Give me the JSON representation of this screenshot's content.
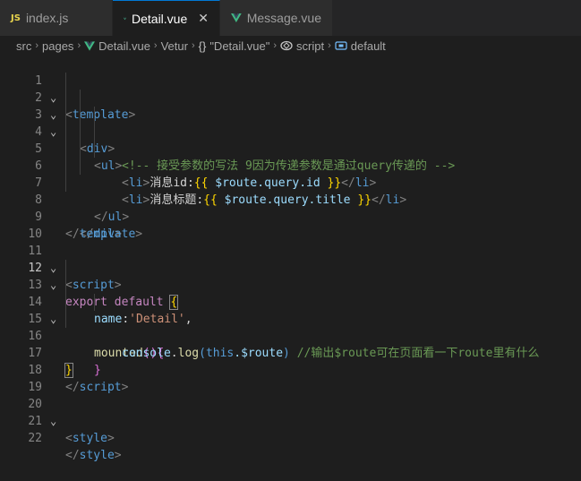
{
  "tabs": [
    {
      "label": "index.js",
      "icon": "js-icon",
      "active": false
    },
    {
      "label": "Detail.vue",
      "icon": "vue-icon",
      "active": true,
      "close": "✕"
    },
    {
      "label": "Message.vue",
      "icon": "vue-icon",
      "active": false
    }
  ],
  "breadcrumb": {
    "items": [
      "src",
      "pages",
      "Detail.vue",
      "Vetur",
      "\"Detail.vue\"",
      "script",
      "default"
    ],
    "separator": "›"
  },
  "line_numbers": [
    "1",
    "2",
    "3",
    "4",
    "5",
    "6",
    "7",
    "8",
    "9",
    "10",
    "11",
    "12",
    "13",
    "14",
    "15",
    "16",
    "17",
    "18",
    "19",
    "20",
    "21",
    "22"
  ],
  "active_line": "12",
  "code": {
    "l1": {
      "a": "<",
      "b": "template",
      "c": ">"
    },
    "l2": {
      "a": "<",
      "b": "div",
      "c": ">"
    },
    "l3": {
      "a": "<",
      "b": "ul",
      "c": ">"
    },
    "l4": {
      "comment": "<!-- 接受参数的写法 9因为传递参数是通过query传递的 -->"
    },
    "l5": {
      "open": "<",
      "tag": "li",
      "close": ">",
      "text": "消息id:",
      "m1": "{{",
      "expr": " $route.query.id ",
      "m2": "}}",
      "eopen": "</",
      "etag": "li",
      "eclose": ">"
    },
    "l6": {
      "open": "<",
      "tag": "li",
      "close": ">",
      "text": "消息标题:",
      "m1": "{{",
      "expr": " $route.query.title ",
      "m2": "}}",
      "eopen": "</",
      "etag": "li",
      "eclose": ">"
    },
    "l7": {
      "a": "</",
      "b": "ul",
      "c": ">"
    },
    "l8": {
      "a": "</",
      "b": "div",
      "c": ">"
    },
    "l9": {
      "a": "</",
      "b": "template",
      "c": ">"
    },
    "l11": {
      "a": "<",
      "b": "script",
      "c": ">"
    },
    "l12": {
      "kw1": "export",
      "kw2": "default",
      "brace": "{"
    },
    "l13": {
      "key": "name",
      "colon": ":",
      "str": "'Detail'",
      "comma": ","
    },
    "l14": {
      "fn": "mounted",
      "paren": "()",
      "brace": "{"
    },
    "l15": {
      "obj": "console",
      "dot": ".",
      "fn": "log",
      "p1": "(",
      "this": "this",
      "rest": ".$route",
      "p2": ")",
      "comment": "//输出$route可在页面看一下route里有什么"
    },
    "l16": {
      "brace": "}"
    },
    "l17": {
      "brace": "}"
    },
    "l18": {
      "a": "</",
      "b": "script",
      "c": ">"
    },
    "l20": {
      "a": "<",
      "b": "style",
      "c": ">"
    },
    "l22": {
      "a": "</",
      "b": "style",
      "c": ">"
    }
  },
  "colors": {
    "tag": "#569cd6",
    "comment": "#6a9955",
    "mustache": "#ffd700",
    "variable": "#9cdcfe",
    "keyword": "#c586c0",
    "string": "#ce9178",
    "function": "#dcdcaa"
  }
}
